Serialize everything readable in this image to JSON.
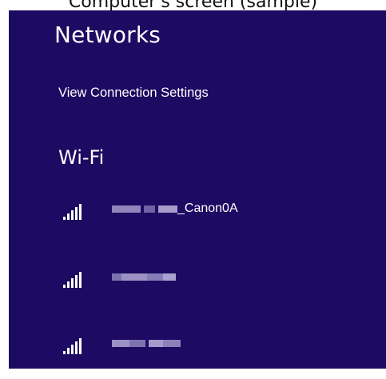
{
  "caption": "Computer's screen (sample)",
  "panel": {
    "title": "Networks",
    "view_settings_link": "View Connection Settings",
    "section": "Wi-Fi",
    "networks": [
      {
        "ssid_suffix": "_Canon0A",
        "icon": "wifi-signal-icon"
      },
      {
        "ssid_suffix": "",
        "icon": "wifi-signal-icon"
      },
      {
        "ssid_suffix": "",
        "icon": "wifi-signal-icon"
      }
    ]
  },
  "colors": {
    "panel_background": "#1d0a62",
    "text": "#ffffff",
    "pixelated_text": "#9c93c4"
  }
}
